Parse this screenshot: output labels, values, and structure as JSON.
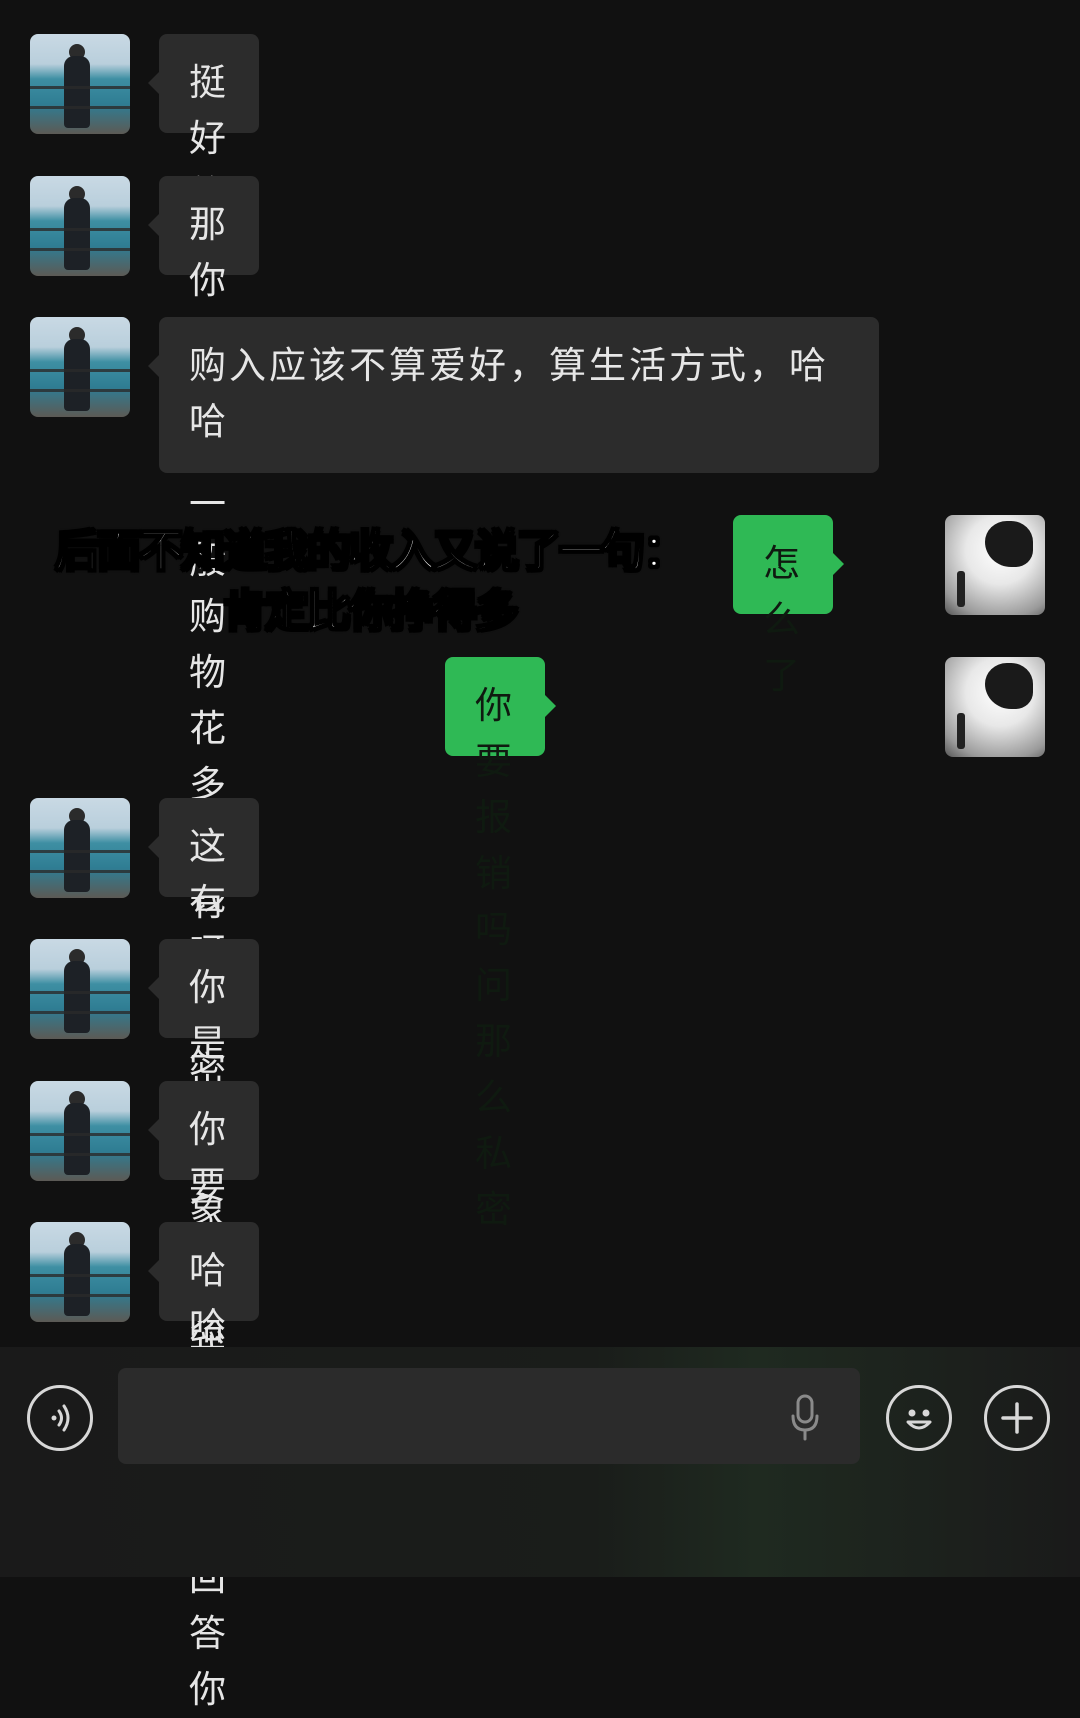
{
  "messages": [
    {
      "side": "peer",
      "text": "挺好的"
    },
    {
      "side": "peer",
      "text": "那你一个月一般购物花多少钱呀"
    },
    {
      "side": "peer",
      "text": "购入应该不算爱好，算生活方式，哈哈"
    },
    {
      "side": "me",
      "text": "怎么了"
    },
    {
      "side": "me",
      "text": "你要报销吗问那么私密"
    },
    {
      "side": "peer",
      "text": "这有啥秘密的"
    },
    {
      "side": "peer",
      "text": "你是我对象自然可以了"
    },
    {
      "side": "peer",
      "text": "你要问我我就可以回答你"
    },
    {
      "side": "peer",
      "text": "哈哈"
    }
  ],
  "overlay_caption": "后面不知道我的收入又说了一句：肯定比你挣得多",
  "input_bar": {
    "voice_icon": "voice-wave-icon",
    "message_value": "",
    "mic_icon": "microphone-icon",
    "emoji_icon": "smiley-icon",
    "plus_icon": "plus-icon"
  },
  "colors": {
    "background": "#111111",
    "peer_bubble": "#2c2c2c",
    "my_bubble": "#2fb955"
  }
}
